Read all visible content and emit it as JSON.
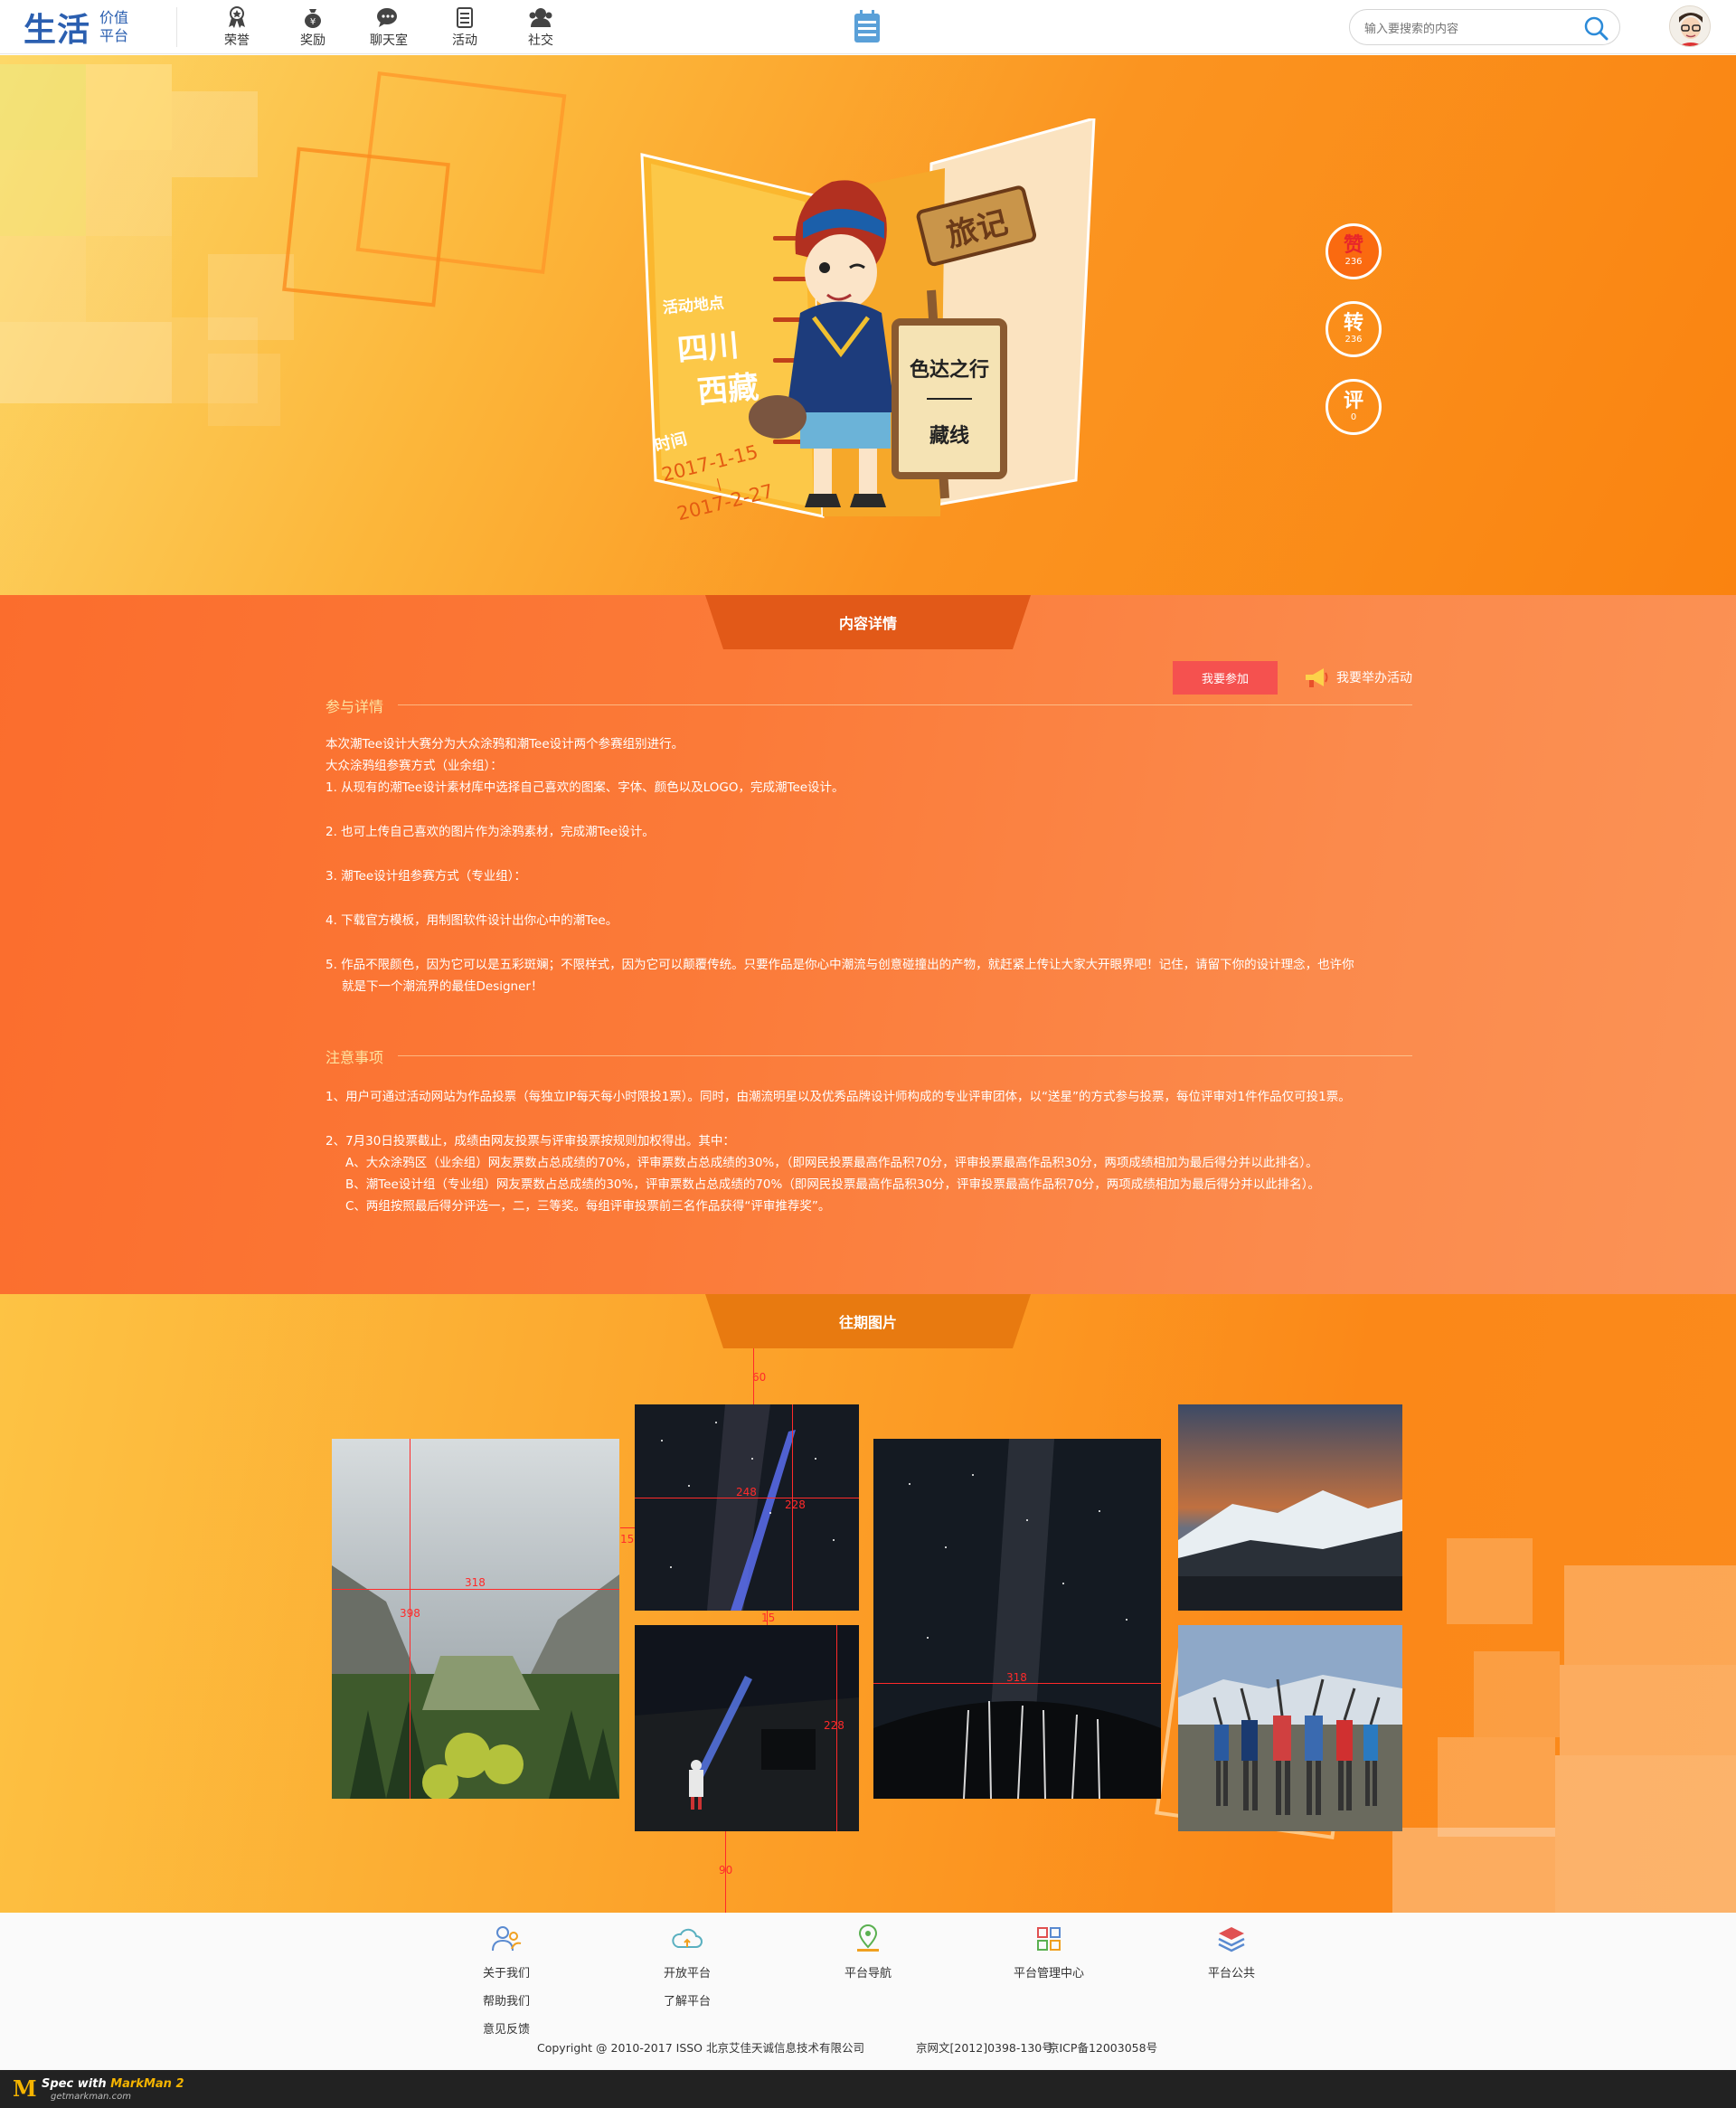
{
  "header": {
    "logo_main": "生活",
    "logo_sub_1": "价值",
    "logo_sub_2": "平台",
    "nav": [
      {
        "label": "荣誉",
        "icon": "medal-icon"
      },
      {
        "label": "奖励",
        "icon": "money-bag-icon"
      },
      {
        "label": "聊天室",
        "icon": "chat-icon"
      },
      {
        "label": "活动",
        "icon": "calendar-list-icon"
      },
      {
        "label": "社交",
        "icon": "people-icon"
      }
    ],
    "search_placeholder": "输入要搜索的内容"
  },
  "hero": {
    "location_label": "活动地点",
    "location_1": "四川",
    "location_2": "西藏",
    "time_label": "时间",
    "date_start": "2017-1-15",
    "date_sep": "|",
    "date_end": "2017-2-27",
    "sign_title": "旅记",
    "route_1": "色达之行",
    "route_2": "藏线",
    "actions": [
      {
        "glyph": "赞",
        "count": "236"
      },
      {
        "glyph": "转",
        "count": "236"
      },
      {
        "glyph": "评",
        "count": "0"
      }
    ]
  },
  "detail": {
    "tab_label": "内容详情",
    "join_button": "我要参加",
    "host_link": "我要举办活动",
    "section1_title": "参与详情",
    "section1_lines": [
      "本次潮Tee设计大赛分为大众涂鸦和潮Tee设计两个参赛组别进行。",
      "大众涂鸦组参赛方式（业余组）：",
      "1. 从现有的潮Tee设计素材库中选择自己喜欢的图案、字体、颜色以及LOGO，完成潮Tee设计。",
      "2. 也可上传自己喜欢的图片作为涂鸦素材，完成潮Tee设计。",
      "3. 潮Tee设计组参赛方式（专业组）：",
      "4. 下载官方模板，用制图软件设计出你心中的潮Tee。",
      "5. 作品不限颜色，因为它可以是五彩斑斓；不限样式，因为它可以颠覆传统。只要作品是你心中潮流与创意碰撞出的产物，就赶紧上传让大家大开眼界吧！记住，请留下你的设计理念，也许你",
      "就是下一个潮流界的最佳Designer！"
    ],
    "section2_title": "注意事项",
    "section2_lines": [
      "1、用户可通过活动网站为作品投票（每独立IP每天每小时限投1票）。同时，由潮流明星以及优秀品牌设计师构成的专业评审团体，以“送星”的方式参与投票，每位评审对1件作品仅可投1票。",
      "2、7月30日投票截止，成绩由网友投票与评审投票按规则加权得出。其中：",
      "A、大众涂鸦区（业余组）网友票数占总成绩的70%，评审票数占总成绩的30%，（即网民投票最高作品积70分，评审投票最高作品积30分，两项成绩相加为最后得分并以此排名）。",
      "B、潮Tee设计组（专业组）网友票数占总成绩的30%，评审票数占总成绩的70%（即网民投票最高作品积30分，评审投票最高作品积70分，两项成绩相加为最后得分并以此排名）。",
      "C、两组按照最后得分评选一，二，三等奖。每组评审投票前三名作品获得“评审推荐奖”。"
    ]
  },
  "gallery": {
    "tab_label": "往期图片",
    "measurements": [
      "60",
      "248",
      "228",
      "15",
      "318",
      "398",
      "15",
      "228",
      "318",
      "90"
    ]
  },
  "footer": {
    "columns": [
      {
        "icon": "users-icon",
        "links": [
          "关于我们",
          "帮助我们",
          "意见反馈"
        ]
      },
      {
        "icon": "cloud-icon",
        "links": [
          "开放平台",
          "了解平台"
        ]
      },
      {
        "icon": "map-pin-icon",
        "links": [
          "平台导航"
        ]
      },
      {
        "icon": "grid-icon",
        "links": [
          "平台管理中心"
        ]
      },
      {
        "icon": "layers-icon",
        "links": [
          "平台公共"
        ]
      }
    ],
    "copyright": "Copyright @ 2010-2017 ISSO 北京艾佳天诚信息技术有限公司",
    "license_1": "京网文[2012]0398-130号",
    "license_2": "京ICP备12003058号"
  },
  "markman": {
    "logo": "M",
    "text_prefix": "Spec with",
    "text_brand": "MarkMan 2",
    "site": "getmarkman.com"
  }
}
